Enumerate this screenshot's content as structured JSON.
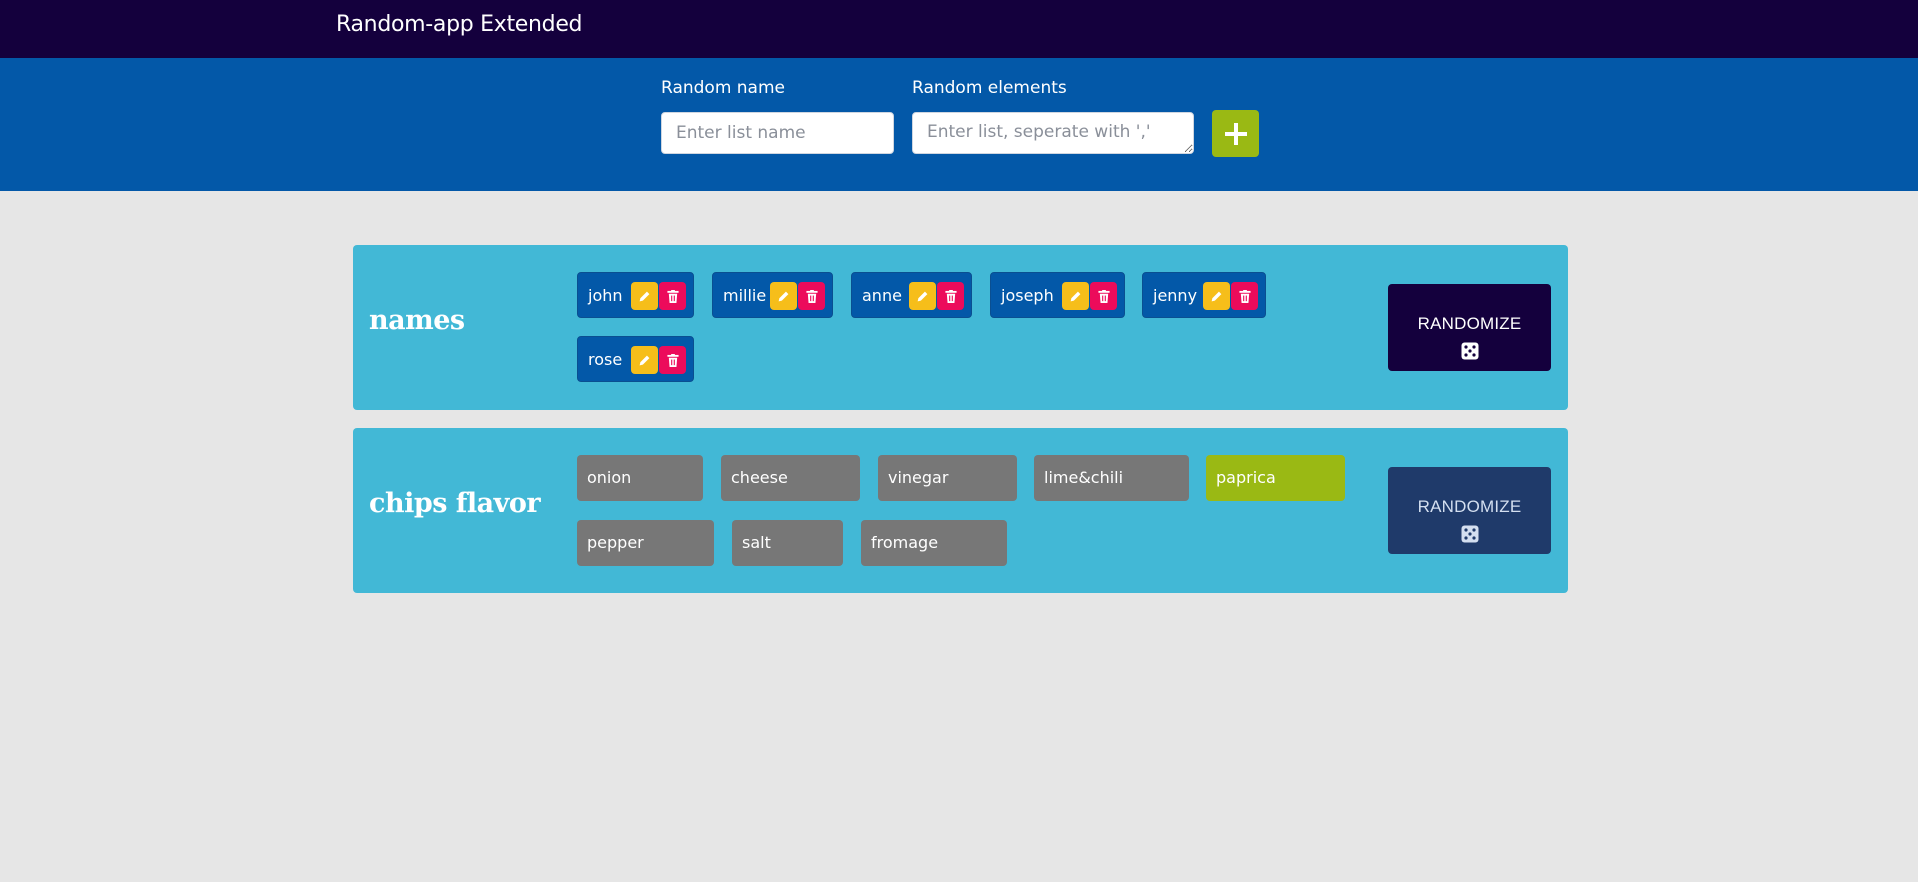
{
  "app": {
    "title": "Random-app Extended"
  },
  "form": {
    "name_label": "Random name",
    "name_placeholder": "Enter list name",
    "elements_label": "Random elements",
    "elements_placeholder": "Enter list, seperate with ','",
    "add_icon": "plus-icon"
  },
  "lists": [
    {
      "title": "names",
      "items": [
        "john",
        "millie",
        "anne",
        "joseph",
        "jenny",
        "rose"
      ],
      "item_icons": [
        "pencil-icon",
        "trash-icon"
      ],
      "randomize_label": "RANDOMIZE",
      "randomize_icon": "dice-icon"
    },
    {
      "title": "chips flavor",
      "items": [
        "onion",
        "cheese",
        "vinegar",
        "lime&chili",
        "paprica",
        "pepper",
        "salt",
        "fromage"
      ],
      "selected_item": "paprica",
      "randomize_label": "RANDOMIZE",
      "randomize_icon": "dice-icon"
    }
  ],
  "colors": {
    "topbar": "#14003d",
    "formbar": "#0358a8",
    "card": "#42b8d6",
    "chip": "#0358a8",
    "chip_result": "#777777",
    "selected": "#9ab914",
    "edit": "#f6be1a",
    "delete": "#ec0b5b"
  }
}
